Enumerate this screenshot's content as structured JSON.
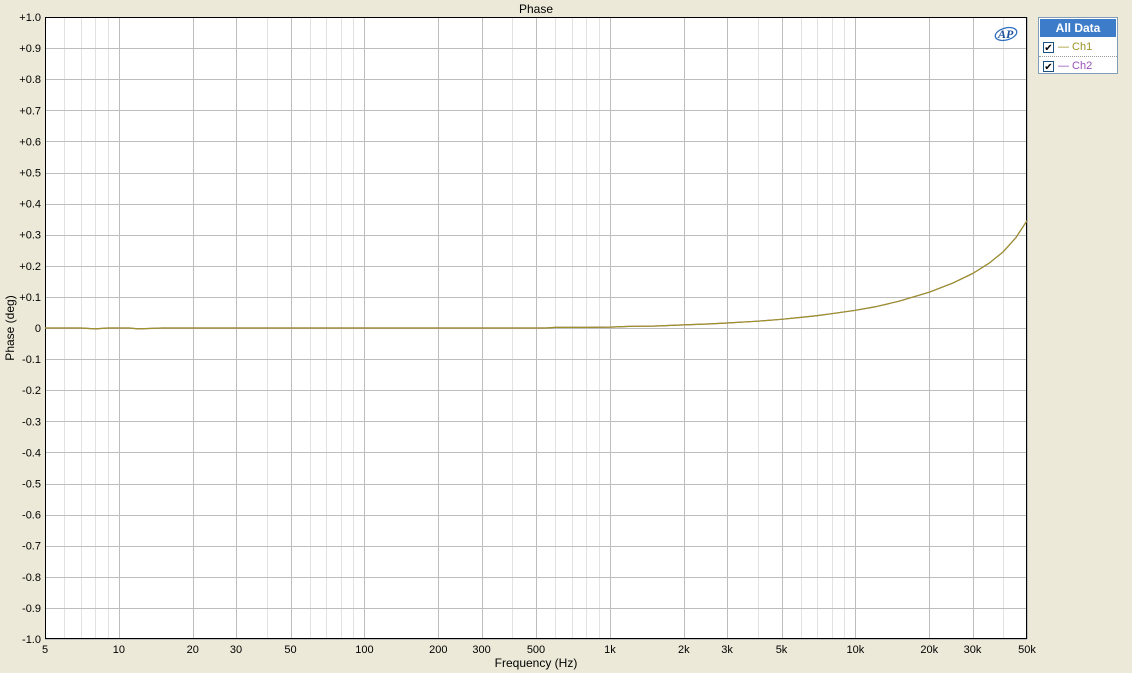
{
  "chart_data": {
    "type": "line",
    "title": "Phase",
    "xlabel": "Frequency (Hz)",
    "ylabel": "Phase (deg)",
    "xscale": "log",
    "xlim": [
      5,
      50000
    ],
    "ylim": [
      -1.0,
      1.0
    ],
    "grid": true,
    "legend_placement": "top-right",
    "x_ticks": [
      {
        "value": 5,
        "label": "5"
      },
      {
        "value": 10,
        "label": "10"
      },
      {
        "value": 20,
        "label": "20"
      },
      {
        "value": 30,
        "label": "30"
      },
      {
        "value": 50,
        "label": "50"
      },
      {
        "value": 100,
        "label": "100"
      },
      {
        "value": 200,
        "label": "200"
      },
      {
        "value": 300,
        "label": "300"
      },
      {
        "value": 500,
        "label": "500"
      },
      {
        "value": 1000,
        "label": "1k"
      },
      {
        "value": 2000,
        "label": "2k"
      },
      {
        "value": 3000,
        "label": "3k"
      },
      {
        "value": 5000,
        "label": "5k"
      },
      {
        "value": 10000,
        "label": "10k"
      },
      {
        "value": 20000,
        "label": "20k"
      },
      {
        "value": 30000,
        "label": "30k"
      },
      {
        "value": 50000,
        "label": "50k"
      }
    ],
    "y_ticks": [
      {
        "value": 1.0,
        "label": "+1.0"
      },
      {
        "value": 0.9,
        "label": "+0.9"
      },
      {
        "value": 0.8,
        "label": "+0.8"
      },
      {
        "value": 0.7,
        "label": "+0.7"
      },
      {
        "value": 0.6,
        "label": "+0.6"
      },
      {
        "value": 0.5,
        "label": "+0.5"
      },
      {
        "value": 0.4,
        "label": "+0.4"
      },
      {
        "value": 0.3,
        "label": "+0.3"
      },
      {
        "value": 0.2,
        "label": "+0.2"
      },
      {
        "value": 0.1,
        "label": "+0.1"
      },
      {
        "value": 0,
        "label": "0"
      },
      {
        "value": -0.1,
        "label": "-0.1"
      },
      {
        "value": -0.2,
        "label": "-0.2"
      },
      {
        "value": -0.3,
        "label": "-0.3"
      },
      {
        "value": -0.4,
        "label": "-0.4"
      },
      {
        "value": -0.5,
        "label": "-0.5"
      },
      {
        "value": -0.6,
        "label": "-0.6"
      },
      {
        "value": -0.7,
        "label": "-0.7"
      },
      {
        "value": -0.8,
        "label": "-0.8"
      },
      {
        "value": -0.9,
        "label": "-0.9"
      },
      {
        "value": -1.0,
        "label": "-1.0"
      }
    ],
    "series": [
      {
        "name": "Ch1",
        "color": "#9c9424",
        "x": [
          5,
          6,
          7,
          8,
          9,
          10,
          11,
          12,
          15,
          20,
          50,
          100,
          200,
          500,
          550,
          600,
          700,
          800,
          1000,
          1200,
          1500,
          2000,
          2500,
          3000,
          4000,
          5000,
          6000,
          7000,
          8000,
          10000,
          12000,
          15000,
          20000,
          25000,
          30000,
          35000,
          40000,
          45000,
          50000
        ],
        "y": [
          0,
          0,
          0,
          -0.003,
          0,
          0,
          0,
          -0.003,
          0,
          0,
          0,
          0,
          0,
          0,
          0,
          0.002,
          0.002,
          0.002,
          0.003,
          0.005,
          0.006,
          0.01,
          0.013,
          0.016,
          0.022,
          0.028,
          0.034,
          0.04,
          0.046,
          0.057,
          0.068,
          0.086,
          0.115,
          0.145,
          0.175,
          0.208,
          0.245,
          0.29,
          0.345
        ]
      },
      {
        "name": "Ch2",
        "color": "#9a4fb8",
        "x": [
          5,
          6,
          7,
          8,
          9,
          10,
          11,
          12,
          15,
          20,
          50,
          100,
          200,
          500,
          550,
          600,
          700,
          800,
          1000,
          1200,
          1500,
          2000,
          2500,
          3000,
          4000,
          5000,
          6000,
          7000,
          8000,
          10000,
          12000,
          15000,
          20000,
          25000,
          30000,
          35000,
          40000,
          45000,
          50000
        ],
        "y": [
          0,
          0,
          0,
          -0.003,
          0,
          0,
          0,
          -0.003,
          0,
          0,
          0,
          0,
          0,
          0,
          0,
          0.002,
          0.002,
          0.002,
          0.003,
          0.005,
          0.006,
          0.01,
          0.013,
          0.016,
          0.022,
          0.028,
          0.034,
          0.04,
          0.046,
          0.057,
          0.068,
          0.086,
          0.115,
          0.145,
          0.175,
          0.208,
          0.245,
          0.29,
          0.345
        ]
      }
    ]
  },
  "legend": {
    "header": "All Data",
    "items": [
      {
        "label": "— Ch1",
        "color": "#9c9424",
        "checked": "✔"
      },
      {
        "label": "— Ch2",
        "color": "#9a4fb8",
        "checked": "✔"
      }
    ]
  }
}
